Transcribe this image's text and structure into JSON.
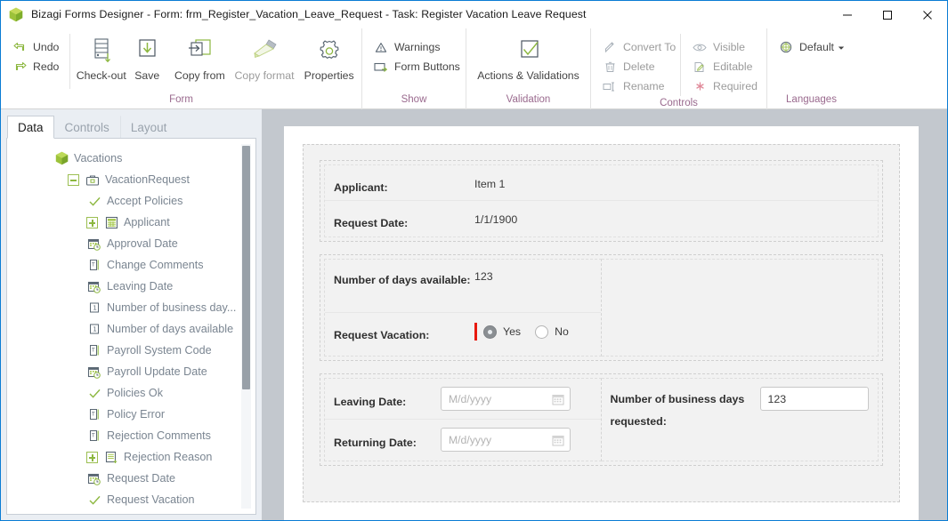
{
  "window": {
    "logo": "bizagi-cube-icon",
    "title": "Bizagi Forms Designer  - Form: frm_Register_Vacation_Leave_Request - Task:  Register Vacation Leave Request",
    "minimize_label": "Minimize",
    "maximize_label": "Maximize",
    "close_label": "Close"
  },
  "ribbon": {
    "groups": [
      {
        "name": "form",
        "label": "Form",
        "small_commands": [
          {
            "label": "Undo",
            "icon": "undo-icon"
          },
          {
            "label": "Redo",
            "icon": "redo-icon"
          }
        ],
        "big_commands": [
          {
            "label": "Check-out",
            "icon": "check-out-icon",
            "disabled": false
          },
          {
            "label": "Save",
            "icon": "save-icon",
            "disabled": false
          },
          {
            "label": "Copy from",
            "icon": "copy-from-icon",
            "disabled": false
          },
          {
            "label": "Copy format",
            "icon": "copy-format-icon",
            "disabled": true
          },
          {
            "label": "Properties",
            "icon": "properties-gear-icon",
            "disabled": false
          }
        ]
      },
      {
        "name": "show",
        "label": "Show",
        "small_commands": [
          {
            "label": "Warnings",
            "icon": "warning-triangle-icon"
          },
          {
            "label": "Form Buttons",
            "icon": "form-buttons-icon"
          }
        ],
        "big_commands": []
      },
      {
        "name": "validation",
        "label": "Validation",
        "small_commands": [],
        "big_commands": [
          {
            "label": "Actions & Validations",
            "icon": "checkmark-box-icon",
            "disabled": false
          }
        ]
      },
      {
        "name": "controls",
        "label": "Controls",
        "small_commands": [
          {
            "label": "Convert To",
            "icon": "convert-to-icon"
          },
          {
            "label": "Delete",
            "icon": "trash-icon"
          },
          {
            "label": "Rename",
            "icon": "rename-icon"
          }
        ],
        "small_commands_2": [
          {
            "label": "Visible",
            "icon": "eye-icon"
          },
          {
            "label": "Editable",
            "icon": "editable-pencil-icon"
          },
          {
            "label": "Required",
            "icon": "required-asterisk-icon"
          }
        ],
        "big_commands": []
      },
      {
        "name": "languages",
        "label": "Languages",
        "small_commands": [
          {
            "label": "Default",
            "icon": "globe-icon",
            "has_dropdown": true
          }
        ],
        "big_commands": []
      }
    ]
  },
  "sidebar": {
    "tabs": [
      {
        "label": "Data",
        "active": true
      },
      {
        "label": "Controls",
        "active": false
      },
      {
        "label": "Layout",
        "active": false
      }
    ],
    "tree": [
      {
        "label": "Vacations",
        "indent": 0,
        "icon": "green-cube-icon",
        "expander": "none"
      },
      {
        "label": "VacationRequest",
        "indent": 1,
        "icon": "entity-case-icon",
        "expander": "minus"
      },
      {
        "label": "Accept Policies",
        "indent": 2,
        "icon": "boolean-check-icon",
        "expander": "none"
      },
      {
        "label": "Applicant",
        "indent": 2,
        "icon": "entity-table-icon",
        "expander": "plus"
      },
      {
        "label": "Approval Date",
        "indent": 2,
        "icon": "datetime-icon",
        "expander": "none"
      },
      {
        "label": "Change Comments",
        "indent": 2,
        "icon": "text-icon",
        "expander": "none"
      },
      {
        "label": "Leaving Date",
        "indent": 2,
        "icon": "datetime-icon",
        "expander": "none"
      },
      {
        "label": "Number of business day...",
        "indent": 2,
        "icon": "number-icon",
        "expander": "none"
      },
      {
        "label": "Number of days available",
        "indent": 2,
        "icon": "number-icon",
        "expander": "none"
      },
      {
        "label": "Payroll System Code",
        "indent": 2,
        "icon": "text-icon",
        "expander": "none"
      },
      {
        "label": "Payroll Update Date",
        "indent": 2,
        "icon": "datetime-icon",
        "expander": "none"
      },
      {
        "label": "Policies Ok",
        "indent": 2,
        "icon": "boolean-check-icon",
        "expander": "none"
      },
      {
        "label": "Policy Error",
        "indent": 2,
        "icon": "text-icon",
        "expander": "none"
      },
      {
        "label": "Rejection Comments",
        "indent": 2,
        "icon": "text-icon",
        "expander": "none"
      },
      {
        "label": "Rejection Reason",
        "indent": 2,
        "icon": "entity-list-icon",
        "expander": "plus"
      },
      {
        "label": "Request Date",
        "indent": 2,
        "icon": "datetime-icon",
        "expander": "none"
      },
      {
        "label": "Request Vacation",
        "indent": 2,
        "icon": "boolean-check-icon",
        "expander": "none"
      }
    ]
  },
  "form": {
    "sections": [
      {
        "name": "applicant-section",
        "rows": [
          {
            "label": "Applicant:",
            "value": "Item 1",
            "control": "text-readonly"
          },
          {
            "label": "Request Date:",
            "value": "1/1/1900",
            "control": "text-readonly"
          }
        ]
      },
      {
        "name": "days-section",
        "rows": [
          {
            "label": "Number of days available:",
            "value": "123",
            "control": "text-readonly"
          },
          {
            "label": "Request Vacation:",
            "control": "radio",
            "required": true,
            "options": [
              {
                "label": "Yes",
                "selected": true
              },
              {
                "label": "No",
                "selected": false
              }
            ]
          }
        ]
      },
      {
        "name": "dates-section",
        "left_rows": [
          {
            "label": "Leaving Date:",
            "placeholder": "M/d/yyyy",
            "value": "",
            "control": "date"
          },
          {
            "label": "Returning Date:",
            "placeholder": "M/d/yyyy",
            "value": "",
            "control": "date"
          }
        ],
        "right_rows": [
          {
            "label": "Number of business days requested:",
            "value": "123",
            "control": "textbox"
          }
        ]
      }
    ]
  },
  "colors": {
    "accent_blue": "#0a7cd4",
    "brand_green": "#8cb73f",
    "group_label": "#9a6a8e",
    "required_red": "#e8190f",
    "panel_bg": "#c3c8ce"
  }
}
